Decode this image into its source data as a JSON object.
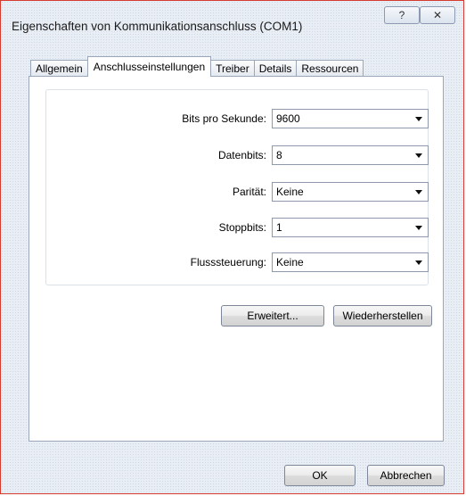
{
  "window": {
    "title": "Eigenschaften von Kommunikationsanschluss (COM1)",
    "help_glyph": "?",
    "close_glyph": "✕"
  },
  "tabs": [
    {
      "label": "Allgemein",
      "active": false
    },
    {
      "label": "Anschlusseinstellungen",
      "active": true
    },
    {
      "label": "Treiber",
      "active": false
    },
    {
      "label": "Details",
      "active": false
    },
    {
      "label": "Ressourcen",
      "active": false
    }
  ],
  "settings": {
    "bits": {
      "label": "Bits pro Sekunde:",
      "value": "9600"
    },
    "datenbits": {
      "label": "Datenbits:",
      "value": "8"
    },
    "paritaet": {
      "label": "Parität:",
      "value": "Keine"
    },
    "stoppbits": {
      "label": "Stoppbits:",
      "value": "1"
    },
    "fluss": {
      "label": "Flusssteuerung:",
      "value": "Keine"
    }
  },
  "buttons": {
    "erweitert": "Erweitert...",
    "wiederherstellen": "Wiederherstellen",
    "ok": "OK",
    "abbrechen": "Abbrechen"
  }
}
